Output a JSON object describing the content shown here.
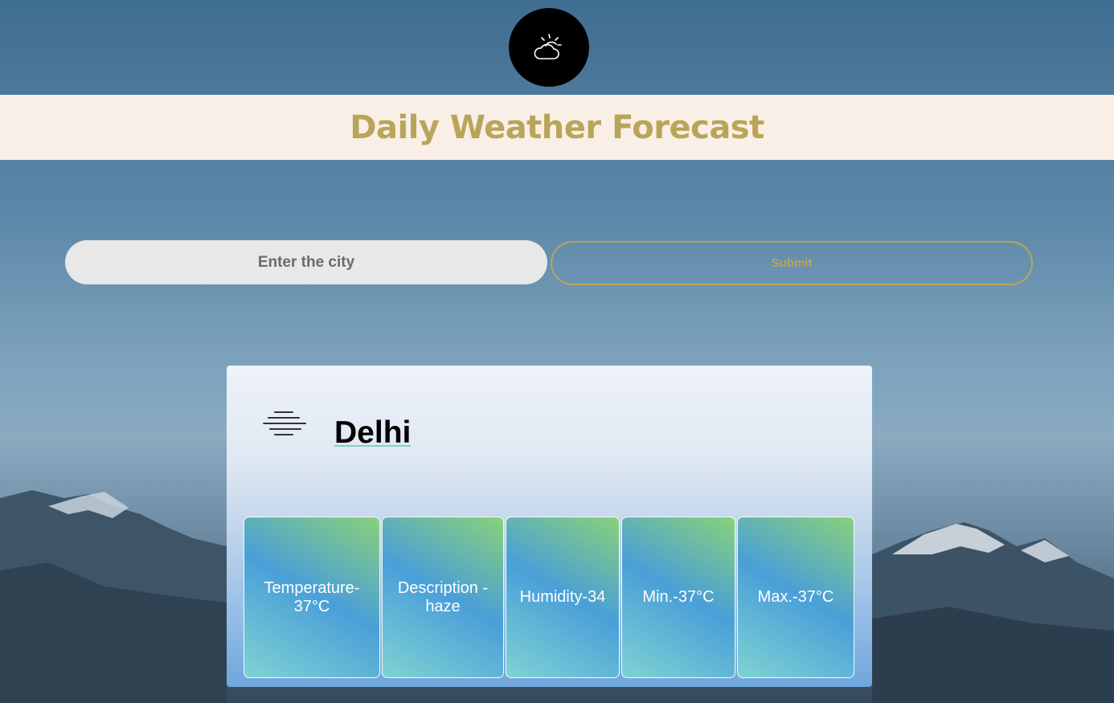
{
  "header": {
    "title": "Daily Weather Forecast",
    "logo_icon": "partly-sunny-cloud-icon"
  },
  "search": {
    "placeholder": "Enter the city",
    "value": "",
    "submit_label": "Submit"
  },
  "weather": {
    "city": "Delhi",
    "condition_icon": "haze-icon",
    "stats": [
      {
        "label": "Temperature-37°C"
      },
      {
        "label": "Description - haze"
      },
      {
        "label": "Humidity-34"
      },
      {
        "label": "Min.-37°C"
      },
      {
        "label": "Max.-37°C"
      }
    ]
  },
  "colors": {
    "accent": "#b9a559",
    "banner": "#faefe6",
    "input_bg": "#e8e8e8"
  }
}
